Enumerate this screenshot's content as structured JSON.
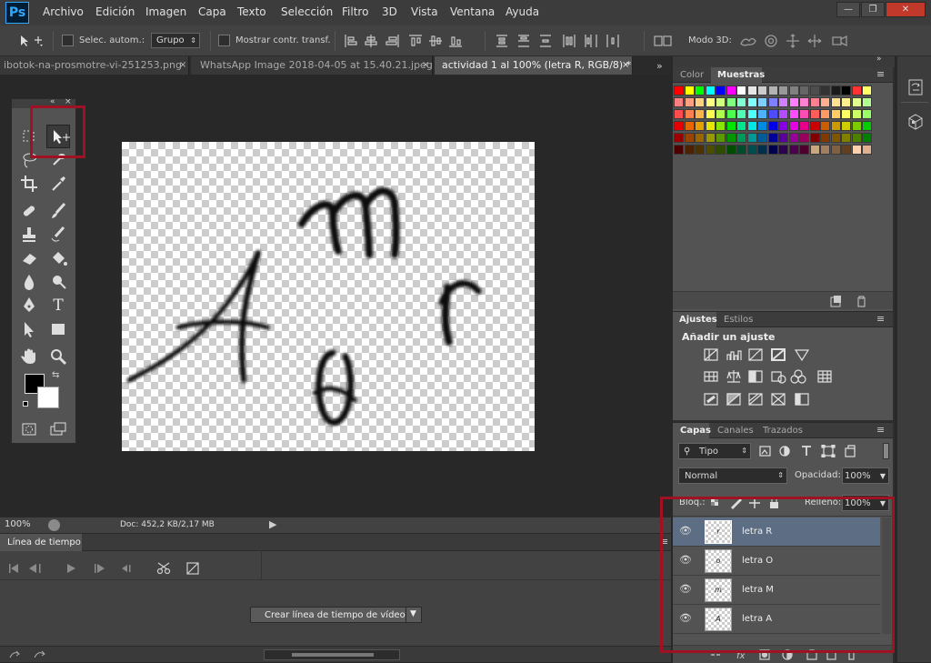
{
  "app": {
    "logo": "Ps"
  },
  "menu": [
    "Archivo",
    "Edición",
    "Imagen",
    "Capa",
    "Texto",
    "Selección",
    "Filtro",
    "3D",
    "Vista",
    "Ventana",
    "Ayuda"
  ],
  "window_controls": {
    "minimize": "—",
    "restore": "❐",
    "close": "✕"
  },
  "options": {
    "auto_select_label": "Selec. autom.:",
    "auto_select_value": "Grupo",
    "show_transform_label": "Mostrar contr. transf.",
    "mode3d_label": "Modo 3D:"
  },
  "tabs": [
    {
      "label": "ibotok-na-prosmotre-vi-251253.png",
      "close": "×"
    },
    {
      "label": "WhatsApp Image 2018-04-05 at 15.40.21.jpeg",
      "close": "×"
    },
    {
      "label": "actividad 1 al 100% (letra R, RGB/8) *",
      "close": "×"
    }
  ],
  "canvas_letters": [
    "A",
    "m",
    "o",
    "r"
  ],
  "status": {
    "zoom": "100%",
    "doc": "Doc: 452,2 KB/2,17 MB"
  },
  "timeline": {
    "tab": "Línea de tiempo",
    "create_button": "Crear línea de tiempo de vídeo"
  },
  "color_panel": {
    "tabs": [
      "Color",
      "Muestras"
    ],
    "swatches": [
      "#ff0000",
      "#ffff00",
      "#00ff00",
      "#00ffff",
      "#0000ff",
      "#ff00ff",
      "#ffffff",
      "#e6e6e6",
      "#cccccc",
      "#b3b3b3",
      "#999999",
      "#808080",
      "#666666",
      "#4d4d4d",
      "#333333",
      "#1a1a1a",
      "#000000",
      "#ff3333",
      "#ffff66",
      "#ff8080",
      "#ffa080",
      "#ffd080",
      "#ffff80",
      "#d0ff80",
      "#80ff80",
      "#80ffd0",
      "#80ffff",
      "#80d0ff",
      "#8080ff",
      "#d080ff",
      "#ff80ff",
      "#ff80d0",
      "#ff8090",
      "#ffb090",
      "#ffe090",
      "#fff090",
      "#e0ff90",
      "#b0ff90",
      "#ff4d4d",
      "#ff804d",
      "#ffb34d",
      "#ffff4d",
      "#b3ff4d",
      "#4dff4d",
      "#4dffb3",
      "#4dffff",
      "#4db3ff",
      "#4d4dff",
      "#b34dff",
      "#ff4dff",
      "#ff4db3",
      "#ff5c5c",
      "#ff9966",
      "#ffcc66",
      "#ffff66",
      "#ccff66",
      "#99ff66",
      "#e60000",
      "#e66700",
      "#e6a000",
      "#e6e600",
      "#8ae600",
      "#00e600",
      "#00e68a",
      "#00e6e6",
      "#008ae6",
      "#0000e6",
      "#8a00e6",
      "#e600e6",
      "#e6008a",
      "#cc0000",
      "#cc5c00",
      "#cc9900",
      "#cccc00",
      "#7acc00",
      "#00cc00",
      "#990000",
      "#994400",
      "#996600",
      "#999900",
      "#5c9900",
      "#009900",
      "#00995c",
      "#009999",
      "#005c99",
      "#000099",
      "#5c0099",
      "#990099",
      "#99005c",
      "#800000",
      "#803900",
      "#805500",
      "#808000",
      "#4d8000",
      "#008000",
      "#4d0000",
      "#4d2200",
      "#4d3300",
      "#4d4d00",
      "#2e4d00",
      "#004d00",
      "#004d2e",
      "#004d4d",
      "#002e4d",
      "#00004d",
      "#2e004d",
      "#4d004d",
      "#4d002e",
      "#c8a880",
      "#a08060",
      "#806040",
      "#604020",
      "#ffd0b0",
      "#e0b090"
    ]
  },
  "adjustments": {
    "tabs": [
      "Ajustes",
      "Estilos"
    ],
    "title": "Añadir un ajuste"
  },
  "layers_panel": {
    "tabs": [
      "Capas",
      "Canales",
      "Trazados"
    ],
    "filter_label": "Tipo",
    "blend_mode": "Normal",
    "opacity_label": "Opacidad:",
    "opacity_value": "100%",
    "lock_label": "Bloq.:",
    "fill_label": "Relleno:",
    "fill_value": "100%",
    "layers": [
      {
        "name": "letra R",
        "thumb": "r",
        "selected": true
      },
      {
        "name": "letra O",
        "thumb": "o",
        "selected": false
      },
      {
        "name": "letra M",
        "thumb": "m",
        "selected": false
      },
      {
        "name": "letra A",
        "thumb": "A",
        "selected": false
      }
    ]
  },
  "colors": {
    "highlight_red": "#a01124",
    "selected_layer": "#5c6d84",
    "panel_bg": "#535353"
  }
}
